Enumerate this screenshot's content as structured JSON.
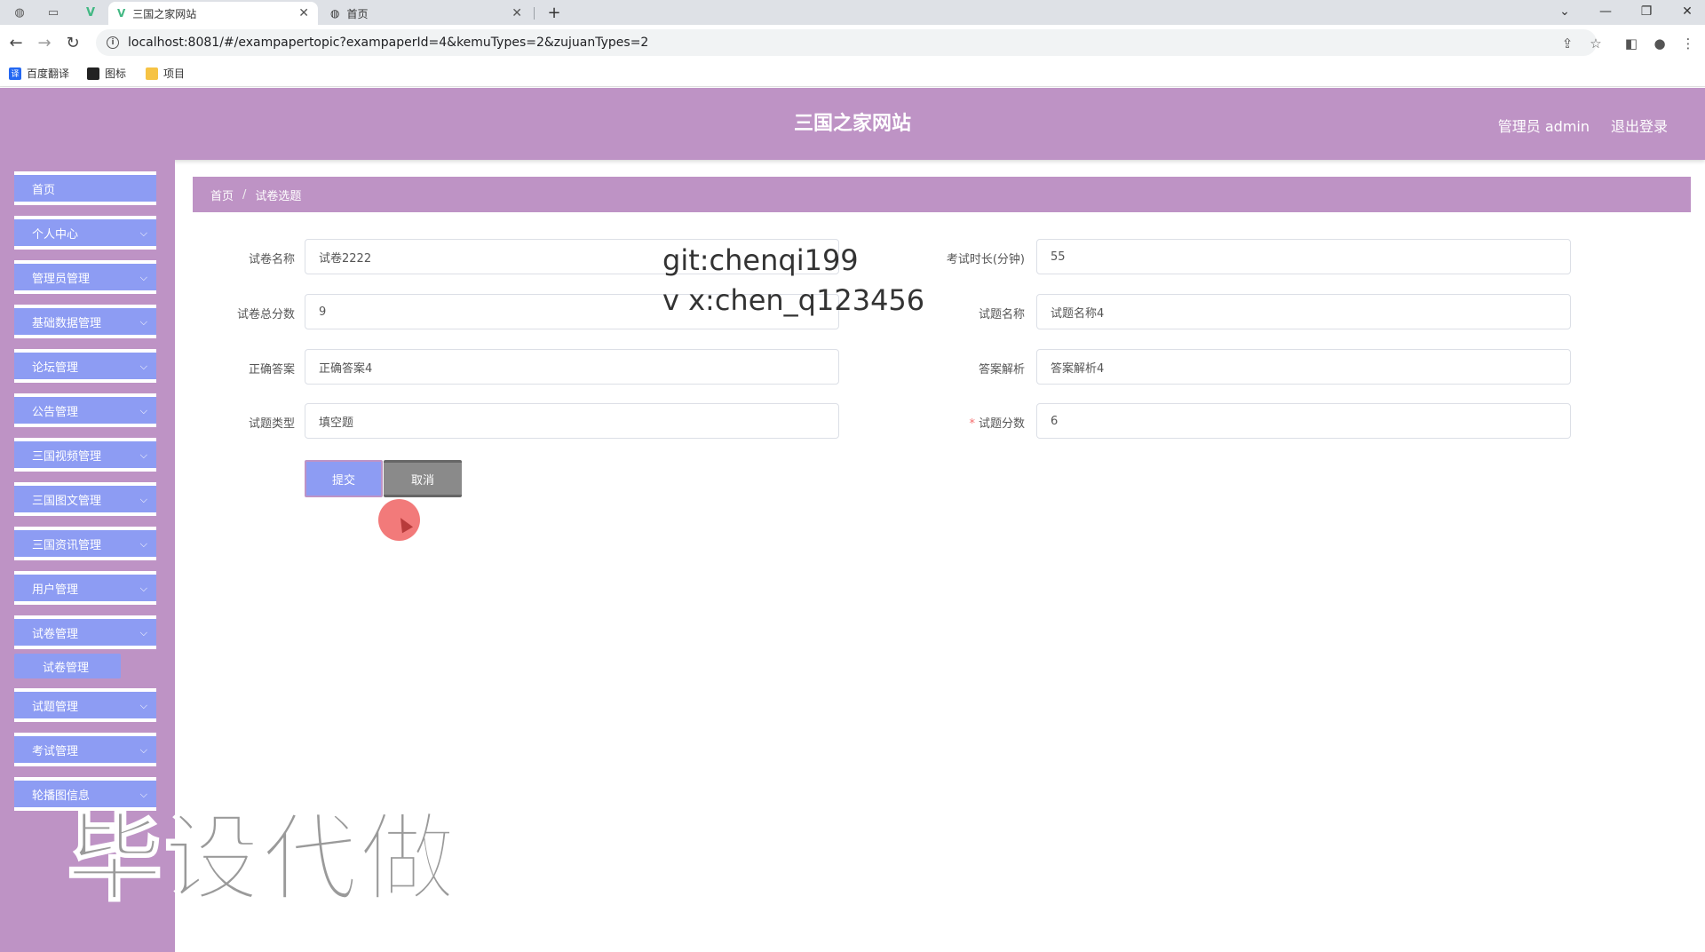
{
  "browser": {
    "tabs": [
      {
        "label": "三国之家网站",
        "active": true
      },
      {
        "label": "首页",
        "active": false
      }
    ],
    "new_tab_icon": "plus",
    "url": "localhost:8081/#/exampapertopic?exampaperId=4&kemuTypes=2&zujuanTypes=2",
    "bookmarks": [
      {
        "label": "百度翻译",
        "icon_text": "译",
        "color": "#2468f2"
      },
      {
        "label": "图标",
        "icon_text": "",
        "color": "#222222"
      },
      {
        "label": "项目",
        "icon_text": "",
        "color": "#f6c344"
      }
    ]
  },
  "header": {
    "title": "三国之家网站",
    "admin": "管理员 admin",
    "logout": "退出登录",
    "color": "#be93c5"
  },
  "sidebar": {
    "items": [
      {
        "label": "首页",
        "has_chevron": false
      },
      {
        "label": "个人中心",
        "has_chevron": true
      },
      {
        "label": "管理员管理",
        "has_chevron": true
      },
      {
        "label": "基础数据管理",
        "has_chevron": true
      },
      {
        "label": "论坛管理",
        "has_chevron": true
      },
      {
        "label": "公告管理",
        "has_chevron": true
      },
      {
        "label": "三国视频管理",
        "has_chevron": true
      },
      {
        "label": "三国图文管理",
        "has_chevron": true
      },
      {
        "label": "三国资讯管理",
        "has_chevron": true
      },
      {
        "label": "用户管理",
        "has_chevron": true
      },
      {
        "label": "试卷管理",
        "has_chevron": true
      },
      {
        "label": "试题管理",
        "has_chevron": true
      },
      {
        "label": "考试管理",
        "has_chevron": true
      },
      {
        "label": "轮播图信息",
        "has_chevron": true
      }
    ],
    "sub_item": "试卷管理",
    "item_color": "#8d9cf3"
  },
  "breadcrumb": {
    "home": "首页",
    "separator": "/",
    "current": "试卷选题"
  },
  "form": {
    "paper_name": {
      "label": "试卷名称",
      "value": "试卷2222"
    },
    "exam_duration": {
      "label": "考试时长(分钟)",
      "value": "55"
    },
    "paper_total_score": {
      "label": "试卷总分数",
      "value": "9"
    },
    "question_name": {
      "label": "试题名称",
      "value": "试题名称4"
    },
    "correct_answer": {
      "label": "正确答案",
      "value": "正确答案4"
    },
    "answer_analysis": {
      "label": "答案解析",
      "value": "答案解析4"
    },
    "question_type": {
      "label": "试题类型",
      "value": "填空题"
    },
    "question_score": {
      "label": "试题分数",
      "value": "6",
      "required_mark": "*"
    }
  },
  "buttons": {
    "submit": "提交",
    "cancel": "取消"
  },
  "overlays": {
    "git_line": "git:chenqi199",
    "wechat_line": "v x:chen_q123456",
    "watermark": "毕设代做"
  }
}
